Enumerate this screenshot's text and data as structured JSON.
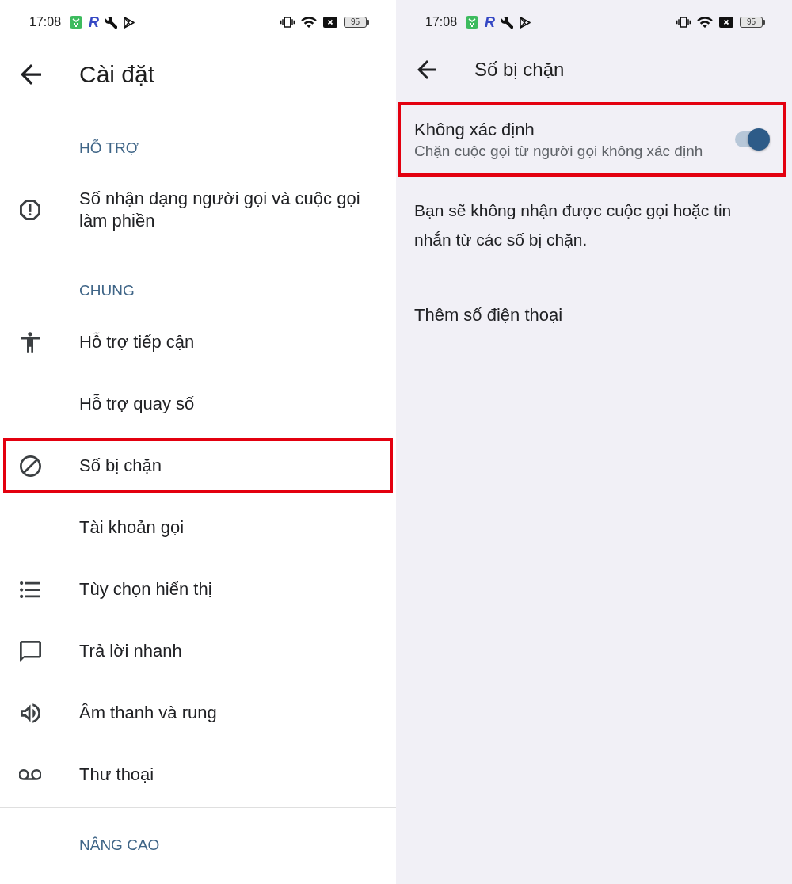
{
  "left_screen": {
    "status_bar": {
      "time": "17:08",
      "app_letter": "R",
      "battery": "95"
    },
    "header": {
      "title": "Cài đặt"
    },
    "sections": [
      {
        "heading": "HỖ TRỢ",
        "items": [
          {
            "kind": "alert",
            "label": "Số nhận dạng người gọi và cuộc gọi làm phiền",
            "highlighted": false
          }
        ]
      },
      {
        "heading": "CHUNG",
        "items": [
          {
            "kind": "accessibility",
            "label": "Hỗ trợ tiếp cận",
            "highlighted": false
          },
          {
            "kind": "plain",
            "label": "Hỗ trợ quay số",
            "highlighted": false
          },
          {
            "kind": "blocked",
            "label": "Số bị chặn",
            "highlighted": true
          },
          {
            "kind": "plain",
            "label": "Tài khoản gọi",
            "highlighted": false
          },
          {
            "kind": "list",
            "label": "Tùy chọn hiển thị",
            "highlighted": false
          },
          {
            "kind": "message",
            "label": "Trả lời nhanh",
            "highlighted": false
          },
          {
            "kind": "sound",
            "label": "Âm thanh và rung",
            "highlighted": false
          },
          {
            "kind": "voicemail",
            "label": "Thư thoại",
            "highlighted": false
          }
        ]
      },
      {
        "heading": "NÂNG CAO"
      }
    ]
  },
  "right_screen": {
    "status_bar": {
      "time": "17:08",
      "app_letter": "R",
      "battery": "95"
    },
    "header": {
      "title": "Số bị chặn"
    },
    "option": {
      "title": "Không xác định",
      "subtitle": "Chặn cuộc gọi từ người gọi không xác định",
      "on": true,
      "highlighted": true
    },
    "notice": "Bạn sẽ không nhận được cuộc gọi hoặc tin nhắn từ các số bị chặn.",
    "add_action": "Thêm số điện thoại"
  }
}
